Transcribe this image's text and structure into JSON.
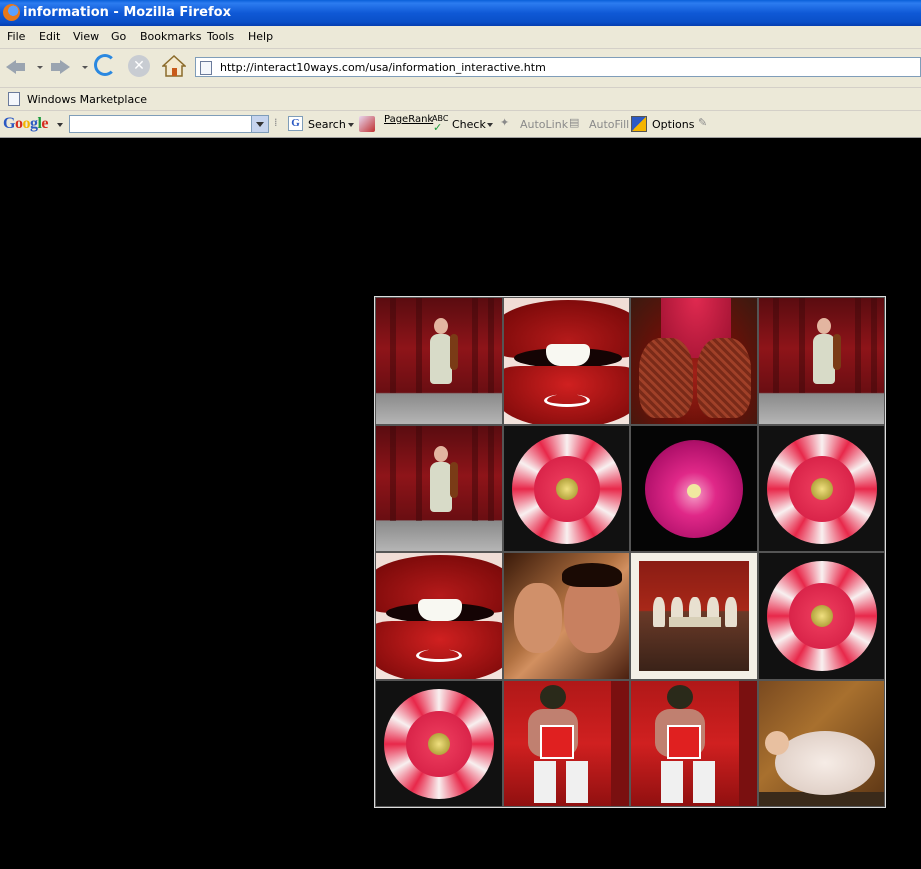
{
  "window": {
    "title": "information - Mozilla Firefox"
  },
  "menu": [
    "File",
    "Edit",
    "View",
    "Go",
    "Bookmarks",
    "Tools",
    "Help"
  ],
  "nav": {
    "url": "http://interact10ways.com/usa/information_interactive.htm"
  },
  "bookmarks": {
    "items": [
      "Windows Marketplace"
    ]
  },
  "google_toolbar": {
    "logo": "Google",
    "search_value": "",
    "search_label": "Search",
    "pagerank_label": "PageRank",
    "abc_label": "ABC",
    "check_label": "Check",
    "autolink_label": "AutoLink",
    "autofill_label": "AutoFill",
    "options_label": "Options"
  },
  "grid": {
    "tiles": [
      "violin-girl",
      "red-lips",
      "henna-hands",
      "violin-girl",
      "violin-girl",
      "red-dahlia",
      "pink-rose",
      "red-dahlia",
      "red-lips",
      "embracing-couple",
      "diner-group",
      "red-dahlia",
      "red-dahlia",
      "masked-wrestler",
      "masked-wrestler",
      "sleeping-girl"
    ]
  },
  "colors": {
    "page_bg": "#000000",
    "titlebar": "#0a52d6",
    "chrome": "#ece9d8"
  }
}
